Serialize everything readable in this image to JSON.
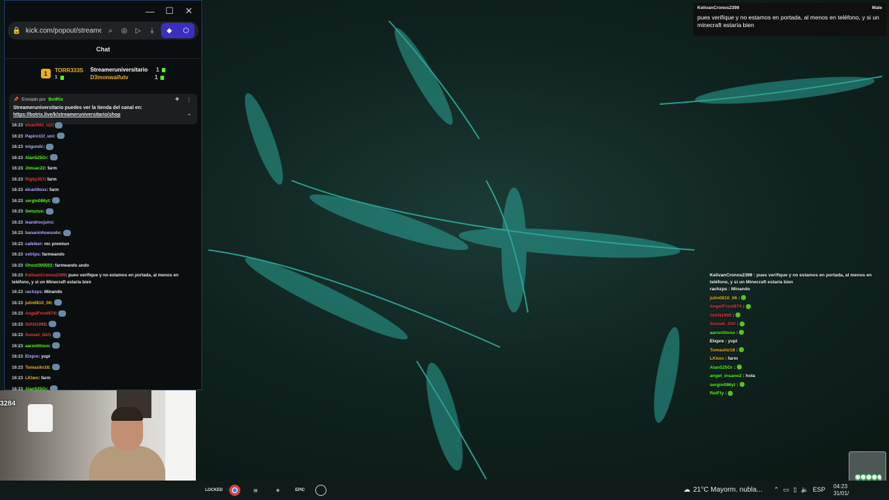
{
  "browser": {
    "url": "kick.com/popout/streame",
    "chat_title": "Chat",
    "window_controls": {
      "minimize": "—",
      "maximize": "☐",
      "close": "✕"
    }
  },
  "leaderboard": {
    "rank_badge": "1",
    "top": {
      "name": "TORR333S",
      "count": "1"
    },
    "second": {
      "name": "Streameruniversitario",
      "count": "1"
    },
    "third": {
      "name": "D3monwaifutv",
      "count": "1"
    }
  },
  "pinned": {
    "sent_by": "Enviado por",
    "author": "BotRix",
    "message": "Streameruniversitario puedes ver la tienda del canal en:",
    "link": "https://botrix.live/k/streameruniversitario/shop"
  },
  "messages": [
    {
      "time": "16:23",
      "user": "elsacthis_uzi",
      "color": "#e83b3b",
      "text": ":",
      "emote": true
    },
    {
      "time": "16:23",
      "user": "Papiro11f_uni",
      "color": "#b9a7ff",
      "text": ":",
      "emote": true
    },
    {
      "time": "16:23",
      "user": "migundc",
      "color": "#b9a7ff",
      "text": ":",
      "emote": true
    },
    {
      "time": "16:23",
      "user": "Alan525Gr",
      "color": "#53fc18",
      "text": ":",
      "emote": true
    },
    {
      "time": "16:23",
      "user": "Jimsac22",
      "color": "#53fc18",
      "text": ": farm",
      "emote": false
    },
    {
      "time": "16:23",
      "user": "Rigby357",
      "color": "#e83b3b",
      "text": ": farm",
      "emote": false
    },
    {
      "time": "16:23",
      "user": "elcarlitoxx",
      "color": "#b9a7ff",
      "text": ": farm",
      "emote": false
    },
    {
      "time": "16:23",
      "user": "sergio086yt",
      "color": "#53fc18",
      "text": ":",
      "emote": true
    },
    {
      "time": "16:23",
      "user": "Senuzux",
      "color": "#53fc18",
      "text": ":",
      "emote": true
    },
    {
      "time": "16:23",
      "user": "leandrocjuiro",
      "color": "#b9a7ff",
      "text": ":",
      "emote": false
    },
    {
      "time": "16:23",
      "user": "bananinhuesudo",
      "color": "#b9a7ff",
      "text": ":",
      "emote": true
    },
    {
      "time": "16:23",
      "user": "cafeiker",
      "color": "#b9a7ff",
      "text": ": mc premiun",
      "emote": false
    },
    {
      "time": "16:23",
      "user": "cetrips",
      "color": "#b9a7ff",
      "text": ": farmeando",
      "emote": false
    },
    {
      "time": "16:23",
      "user": "Ghost300502",
      "color": "#53fc18",
      "text": ": farmeando ando",
      "emote": false
    },
    {
      "time": "16:23",
      "user": "KelivanCronos2399",
      "color": "#e83b3b",
      "text": ": pues verifique y no estamos en portada, al menos en teléfono, y si un Minecraft estaría bien",
      "emote": false,
      "wrap": true
    },
    {
      "time": "16:23",
      "user": "rachzps",
      "color": "#b9a7ff",
      "text": ": Minando",
      "emote": false
    },
    {
      "time": "16:23",
      "user": "julin0810_06",
      "color": "#e8b21c",
      "text": ":",
      "emote": true
    },
    {
      "time": "16:23",
      "user": "AngelFrost974",
      "color": "#e83b3b",
      "text": ":",
      "emote": true
    },
    {
      "time": "16:23",
      "user": "GIAN1998",
      "color": "#e83b3b",
      "text": ":",
      "emote": true
    },
    {
      "time": "16:23",
      "user": "Sunset_Girl",
      "color": "#e83b3b",
      "text": ":",
      "emote": true
    },
    {
      "time": "16:23",
      "user": "aarontitooo",
      "color": "#53fc18",
      "text": ":",
      "emote": true
    },
    {
      "time": "16:23",
      "user": "Elxpre",
      "color": "#b9a7ff",
      "text": ": yupi",
      "emote": false
    },
    {
      "time": "16:23",
      "user": "Tomasito18",
      "color": "#e8b21c",
      "text": ":",
      "emote": true
    },
    {
      "time": "16:23",
      "user": "LKtwo",
      "color": "#e8b21c",
      "text": ": farm",
      "emote": false
    },
    {
      "time": "16:23",
      "user": "Alan525Gr",
      "color": "#53fc18",
      "text": ":",
      "emote": true
    }
  ],
  "webcam_tag": "3284",
  "notification": {
    "user": "KelivanCronos2399",
    "gender": "Male",
    "message": "pues verifique y no estamos en portada, al menos en teléfono, y si un minecraft estaría bien"
  },
  "overlay_chat": [
    {
      "user": "KelivanCronos2399",
      "color": "#ffffff",
      "text": ": pues verifique y no estamos en portada, al menos en teléfono, y si un Minecraft estaría bien",
      "wrap": true
    },
    {
      "user": "rachzps",
      "color": "#ffffff",
      "text": ": Minando"
    },
    {
      "user": "julin0810_06",
      "color": "#e8b21c",
      "text": ":",
      "emote": true
    },
    {
      "user": "AngelFrost974",
      "color": "#e83b3b",
      "text": ":",
      "emote": true
    },
    {
      "user": "GIAN1998",
      "color": "#e83b3b",
      "text": ":",
      "emote": true
    },
    {
      "user": "Sunset_Girl",
      "color": "#e83b3b",
      "text": ":",
      "emote": true
    },
    {
      "user": "aarontitooo",
      "color": "#53fc18",
      "text": ":",
      "emote": true
    },
    {
      "user": "Elxpre",
      "color": "#ffffff",
      "text": ": yupi"
    },
    {
      "user": "Tomasito18",
      "color": "#e8b21c",
      "text": ":",
      "emote": true
    },
    {
      "user": "LKtwo",
      "color": "#e8b21c",
      "text": ": farm"
    },
    {
      "user": "Alan525Gr",
      "color": "#53fc18",
      "text": ":",
      "emote": true
    },
    {
      "user": "angel_insano2",
      "color": "#53fc18",
      "text": ": hola"
    },
    {
      "user": "sergio086yt",
      "color": "#53fc18",
      "text": ":",
      "emote": true
    },
    {
      "user": "RetFly",
      "color": "#53fc18",
      "text": ":",
      "emote": true
    }
  ],
  "taskbar": {
    "apps": [
      "LOCKED",
      "chrome-icon",
      "files-icon",
      "steam-icon",
      "EPIC",
      "obs-icon"
    ],
    "weather": "21°C  Mayorm. nubla...",
    "language": "ESP",
    "time": "04:23",
    "date": "31/01/"
  }
}
